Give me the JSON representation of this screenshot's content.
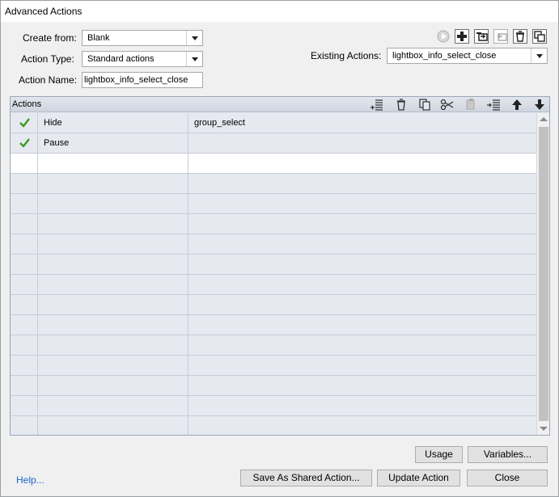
{
  "window": {
    "title": "Advanced Actions"
  },
  "form": {
    "create_from_label": "Create from:",
    "create_from_value": "Blank",
    "action_type_label": "Action Type:",
    "action_type_value": "Standard actions",
    "action_name_label": "Action Name:",
    "action_name_value": "lightbox_info_select_close",
    "existing_label": "Existing Actions:",
    "existing_value": "lightbox_info_select_close"
  },
  "panel": {
    "title": "Actions",
    "rows": [
      {
        "checked": true,
        "action": "Hide",
        "target": "group_select"
      },
      {
        "checked": true,
        "action": "Pause",
        "target": ""
      },
      {
        "checked": false,
        "action": "",
        "target": ""
      },
      {
        "checked": false,
        "action": "",
        "target": ""
      },
      {
        "checked": false,
        "action": "",
        "target": ""
      },
      {
        "checked": false,
        "action": "",
        "target": ""
      },
      {
        "checked": false,
        "action": "",
        "target": ""
      },
      {
        "checked": false,
        "action": "",
        "target": ""
      },
      {
        "checked": false,
        "action": "",
        "target": ""
      },
      {
        "checked": false,
        "action": "",
        "target": ""
      },
      {
        "checked": false,
        "action": "",
        "target": ""
      },
      {
        "checked": false,
        "action": "",
        "target": ""
      },
      {
        "checked": false,
        "action": "",
        "target": ""
      },
      {
        "checked": false,
        "action": "",
        "target": ""
      },
      {
        "checked": false,
        "action": "",
        "target": ""
      },
      {
        "checked": false,
        "action": "",
        "target": ""
      }
    ],
    "selected_row": 2
  },
  "buttons": {
    "usage": "Usage",
    "variables": "Variables...",
    "save_shared": "Save As Shared Action...",
    "update": "Update Action",
    "close": "Close"
  },
  "help_link": "Help...",
  "colors": {
    "check": "#3a9a1a",
    "link": "#1e64c8"
  }
}
